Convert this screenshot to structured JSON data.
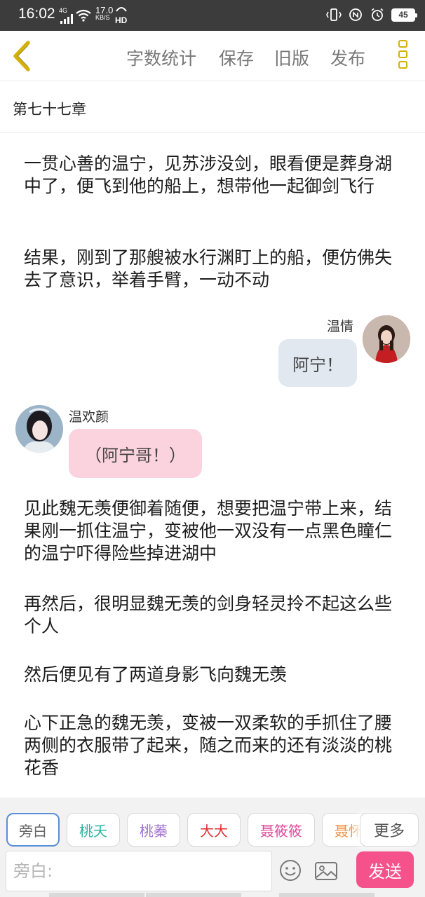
{
  "status_bar": {
    "time": "16:02",
    "network": "4G",
    "speed_value": "17.0",
    "speed_unit": "KB/S",
    "hd": "HD",
    "battery": "45"
  },
  "toolbar": {
    "word_count": "字数统计",
    "save": "保存",
    "old_version": "旧版",
    "publish": "发布"
  },
  "chapter": {
    "title": "第七十七章"
  },
  "content": {
    "para1": "一贯心善的温宁，见苏涉没剑，眼看便是葬身湖中了，便飞到他的船上，想带他一起御剑飞行",
    "para2": "结果，刚到了那艘被水行渊盯上的船，便仿佛失去了意识，举着手臂，一动不动",
    "msg1": {
      "name": "温情",
      "text": "阿宁！"
    },
    "msg2": {
      "name": "温欢颜",
      "text": "（阿宁哥！）"
    },
    "para3": "见此魏无羡便御着随便，想要把温宁带上来，结果刚一抓住温宁，变被他一双没有一点黑色瞳仁的温宁吓得险些掉进湖中",
    "para4": "再然后，很明显魏无羡的剑身轻灵拎不起这么些个人",
    "para5": "然后便见有了两道身影飞向魏无羡",
    "para6": "心下正急的魏无羡，变被一双柔软的手抓住了腰两侧的衣服带了起来，随之而来的还有淡淡的桃花香"
  },
  "roles": [
    {
      "label": "旁白",
      "color": "#666666"
    },
    {
      "label": "桃夭",
      "color": "#2bb5a0"
    },
    {
      "label": "桃蓁",
      "color": "#a070d0"
    },
    {
      "label": "大大",
      "color": "#e03030"
    },
    {
      "label": "聂筱筱",
      "color": "#e0489a"
    },
    {
      "label": "聂怀",
      "color": "#f09040"
    }
  ],
  "more_roles": "更多",
  "input": {
    "placeholder": "旁白:"
  },
  "send": "发送",
  "colors": {
    "accent_yellow": "#d4b107",
    "send_pink": "#f5518a",
    "bubble_blue": "#e1e8f0",
    "bubble_pink": "#fbd3de"
  }
}
